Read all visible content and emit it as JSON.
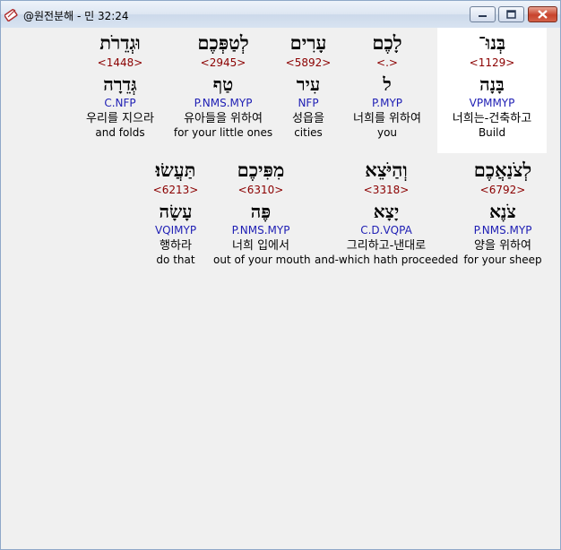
{
  "window": {
    "title": "@원전분해 - 민 32:24"
  },
  "words": [
    {
      "hebrew": "בְּנוּ־",
      "strong": "<1129>",
      "root": "בָּנָה",
      "parse": "VPMMYP",
      "korean": "너희는-건축하고",
      "english": "Build",
      "highlight": true
    },
    {
      "hebrew": "לָכֶם",
      "strong": "<.>",
      "root": "ל",
      "parse": "P.MYP",
      "korean": "너희를 위하여",
      "english": "you",
      "highlight": false
    },
    {
      "hebrew": "עָרִים",
      "strong": "<5892>",
      "root": "עִיר",
      "parse": "NFP",
      "korean": "성읍을",
      "english": "cities",
      "highlight": false
    },
    {
      "hebrew": "לְטַפְּכֶם",
      "strong": "<2945>",
      "root": "טַף",
      "parse": "P.NMS.MYP",
      "korean": "유아들을 위하여",
      "english": "for your little ones",
      "highlight": false
    },
    {
      "hebrew": "וּגְדֵרֹת",
      "strong": "<1448>",
      "root": "גְּדֵרָה",
      "parse": "C.NFP",
      "korean": "우리를 지으라",
      "english": "and folds",
      "highlight": false
    },
    {
      "hebrew": "לְצֹנַאֲכֶם",
      "strong": "<6792>",
      "root": "צֹנֶא",
      "parse": "P.NMS.MYP",
      "korean": "양을 위하여",
      "english": "for your sheep",
      "highlight": false
    },
    {
      "hebrew": "וְהַיֹּצֵא",
      "strong": "<3318>",
      "root": "יָצָא",
      "parse": "C.D.VQPA",
      "korean": "그리하고-낸대로",
      "english": "and-which hath proceeded",
      "highlight": false
    },
    {
      "hebrew": "מִפִּיכֶם",
      "strong": "<6310>",
      "root": "פֶּה",
      "parse": "P.NMS.MYP",
      "korean": "너희 입에서",
      "english": "out of your mouth",
      "highlight": false
    },
    {
      "hebrew": "תַּעֲשׂוּ׃",
      "strong": "<6213>",
      "root": "עָשָׂה",
      "parse": "VQIMYP",
      "korean": "행하라",
      "english": "do that",
      "highlight": false
    }
  ]
}
